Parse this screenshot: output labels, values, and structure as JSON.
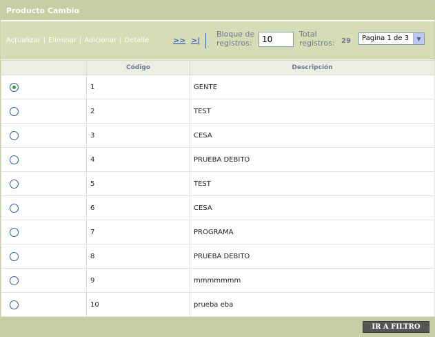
{
  "title": "Producto Cambio",
  "actions": {
    "update": "Actualizar",
    "delete": "Eliminar",
    "add": "Adicionar",
    "detail": "Detalle",
    "separator": "|"
  },
  "pager": {
    "next": ">>",
    "last": ">|",
    "block_label": "Bloque de registros:",
    "block_value": "10",
    "total_label": "Total registros:",
    "total_value": "29",
    "page_selected": "Pagina 1 de 3"
  },
  "table": {
    "headers": {
      "select": "",
      "code": "Código",
      "description": "Descripción"
    },
    "rows": [
      {
        "code": "1",
        "description": "GENTE",
        "selected": true
      },
      {
        "code": "2",
        "description": "TEST",
        "selected": false
      },
      {
        "code": "3",
        "description": "CESA",
        "selected": false
      },
      {
        "code": "4",
        "description": "PRUEBA DEBITO",
        "selected": false
      },
      {
        "code": "5",
        "description": "TEST",
        "selected": false
      },
      {
        "code": "6",
        "description": "CESA",
        "selected": false
      },
      {
        "code": "7",
        "description": "PROGRAMA",
        "selected": false
      },
      {
        "code": "8",
        "description": "PRUEBA DEBITO",
        "selected": false
      },
      {
        "code": "9",
        "description": "mmmmmmm",
        "selected": false
      },
      {
        "code": "10",
        "description": "prueba eba",
        "selected": false
      }
    ]
  },
  "footer": {
    "filter_button": "IR A FILTRO"
  },
  "icons": {
    "select_arrow": "chevron-down-icon",
    "row_select": "radio-icon"
  },
  "colors": {
    "header_bar": "#c6cfa4",
    "toolbar": "#d5dcb6",
    "button": "#555555",
    "link": "#1f3fa8"
  }
}
